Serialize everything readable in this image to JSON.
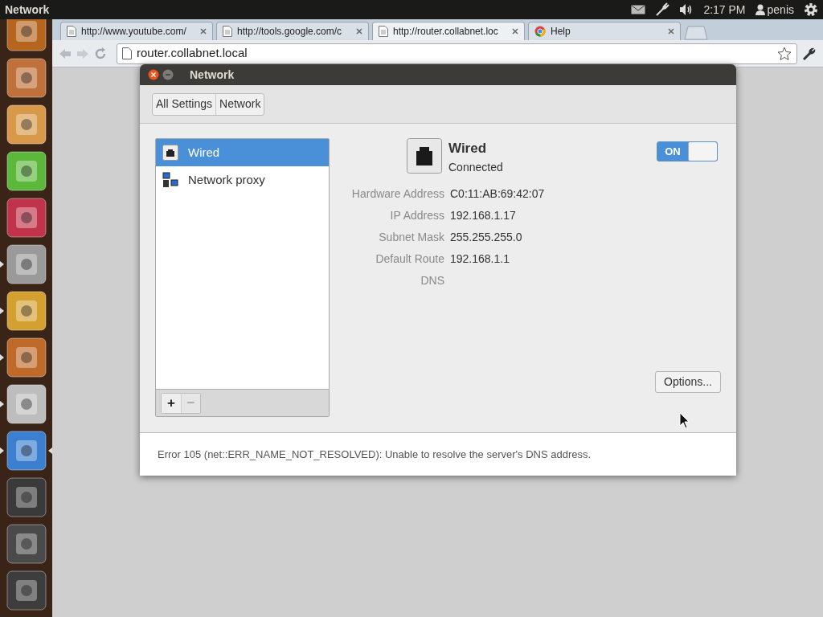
{
  "top_panel": {
    "app_title": "Network",
    "clock": "2:17 PM",
    "user": "penis"
  },
  "launcher": [
    {
      "color": "#b5651d",
      "running": false,
      "active": false
    },
    {
      "color": "#c0703a",
      "running": false,
      "active": false
    },
    {
      "color": "#d89a4a",
      "running": false,
      "active": false
    },
    {
      "color": "#5cb83a",
      "running": false,
      "active": false
    },
    {
      "color": "#c0334a",
      "running": false,
      "active": false
    },
    {
      "color": "#9a9a9a",
      "running": true,
      "active": false
    },
    {
      "color": "#d4a030",
      "running": true,
      "active": false
    },
    {
      "color": "#c06a2a",
      "running": true,
      "active": false
    },
    {
      "color": "#bdbdbd",
      "running": true,
      "active": false
    },
    {
      "color": "#3a7fd0",
      "running": true,
      "active": true
    },
    {
      "color": "#3a3a3a",
      "running": false,
      "active": false
    },
    {
      "color": "#4a4a4a",
      "running": false,
      "active": false
    },
    {
      "color": "#3d3d3d",
      "running": false,
      "active": false
    }
  ],
  "browser": {
    "tabs": [
      {
        "title": "http://www.youtube.com/",
        "selected": false,
        "kind": "page"
      },
      {
        "title": "http://tools.google.com/c",
        "selected": false,
        "kind": "page"
      },
      {
        "title": "http://router.collabnet.loc",
        "selected": true,
        "kind": "page"
      },
      {
        "title": "Help",
        "selected": false,
        "kind": "chrome"
      }
    ],
    "address": "router.collabnet.local",
    "error": "Error 105 (net::ERR_NAME_NOT_RESOLVED): Unable to resolve the server's DNS address."
  },
  "window": {
    "title": "Network",
    "breadcrumbs": [
      "All Settings",
      "Network"
    ],
    "devices": [
      {
        "label": "Wired",
        "selected": true,
        "kind": "wired"
      },
      {
        "label": "Network proxy",
        "selected": false,
        "kind": "proxy"
      }
    ],
    "list_buttons": [
      {
        "label": "+",
        "disabled": false
      },
      {
        "label": "−",
        "disabled": true
      }
    ],
    "device": {
      "name": "Wired",
      "status": "Connected",
      "switch": {
        "label": "ON",
        "on": true
      },
      "details": [
        {
          "label": "Hardware Address",
          "value": "C0:11:AB:69:42:07"
        },
        {
          "label": "IP Address",
          "value": "192.168.1.17"
        },
        {
          "label": "Subnet Mask",
          "value": "255.255.255.0"
        },
        {
          "label": "Default Route",
          "value": "192.168.1.1"
        },
        {
          "label": "DNS"
        }
      ]
    },
    "options_button": "Options..."
  }
}
